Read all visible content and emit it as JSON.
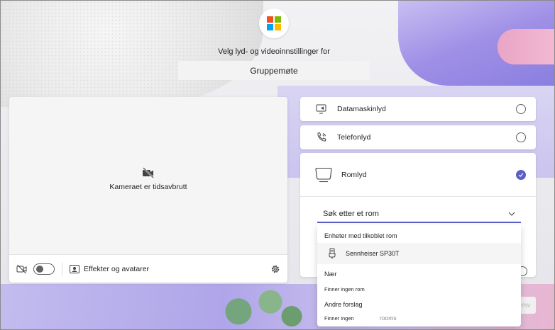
{
  "header": {
    "subtitle": "Velg lyd- og videoinnstillinger for",
    "meeting_name": "Gruppemøte",
    "logo_colors": [
      "#f25022",
      "#7fba00",
      "#00a4ef",
      "#ffb900"
    ]
  },
  "video": {
    "status": "Kameraet er tidsavbrutt",
    "effects_label": "Effekter og avatarer"
  },
  "audio_options": [
    {
      "label": "Datamaskinlyd",
      "icon": "computer-audio-icon",
      "selected": false
    },
    {
      "label": "Telefonlyd",
      "icon": "phone-audio-icon",
      "selected": false
    },
    {
      "label": "Romlyd",
      "icon": "room-audio-icon",
      "selected": true
    }
  ],
  "room_search": {
    "value": "Søk etter et rom",
    "connected_header": "Enheter med tilkoblet rom",
    "connected_device": "Sennheiser SP30T",
    "near_header": "Nær",
    "near_empty": "Finner ingen rom",
    "other_header": "Andre forslag",
    "other_empty": "Finner ingen",
    "other_ghost": "rooms"
  },
  "hidden_button_label": "ew",
  "colors": {
    "accent": "#5b5fc7"
  }
}
